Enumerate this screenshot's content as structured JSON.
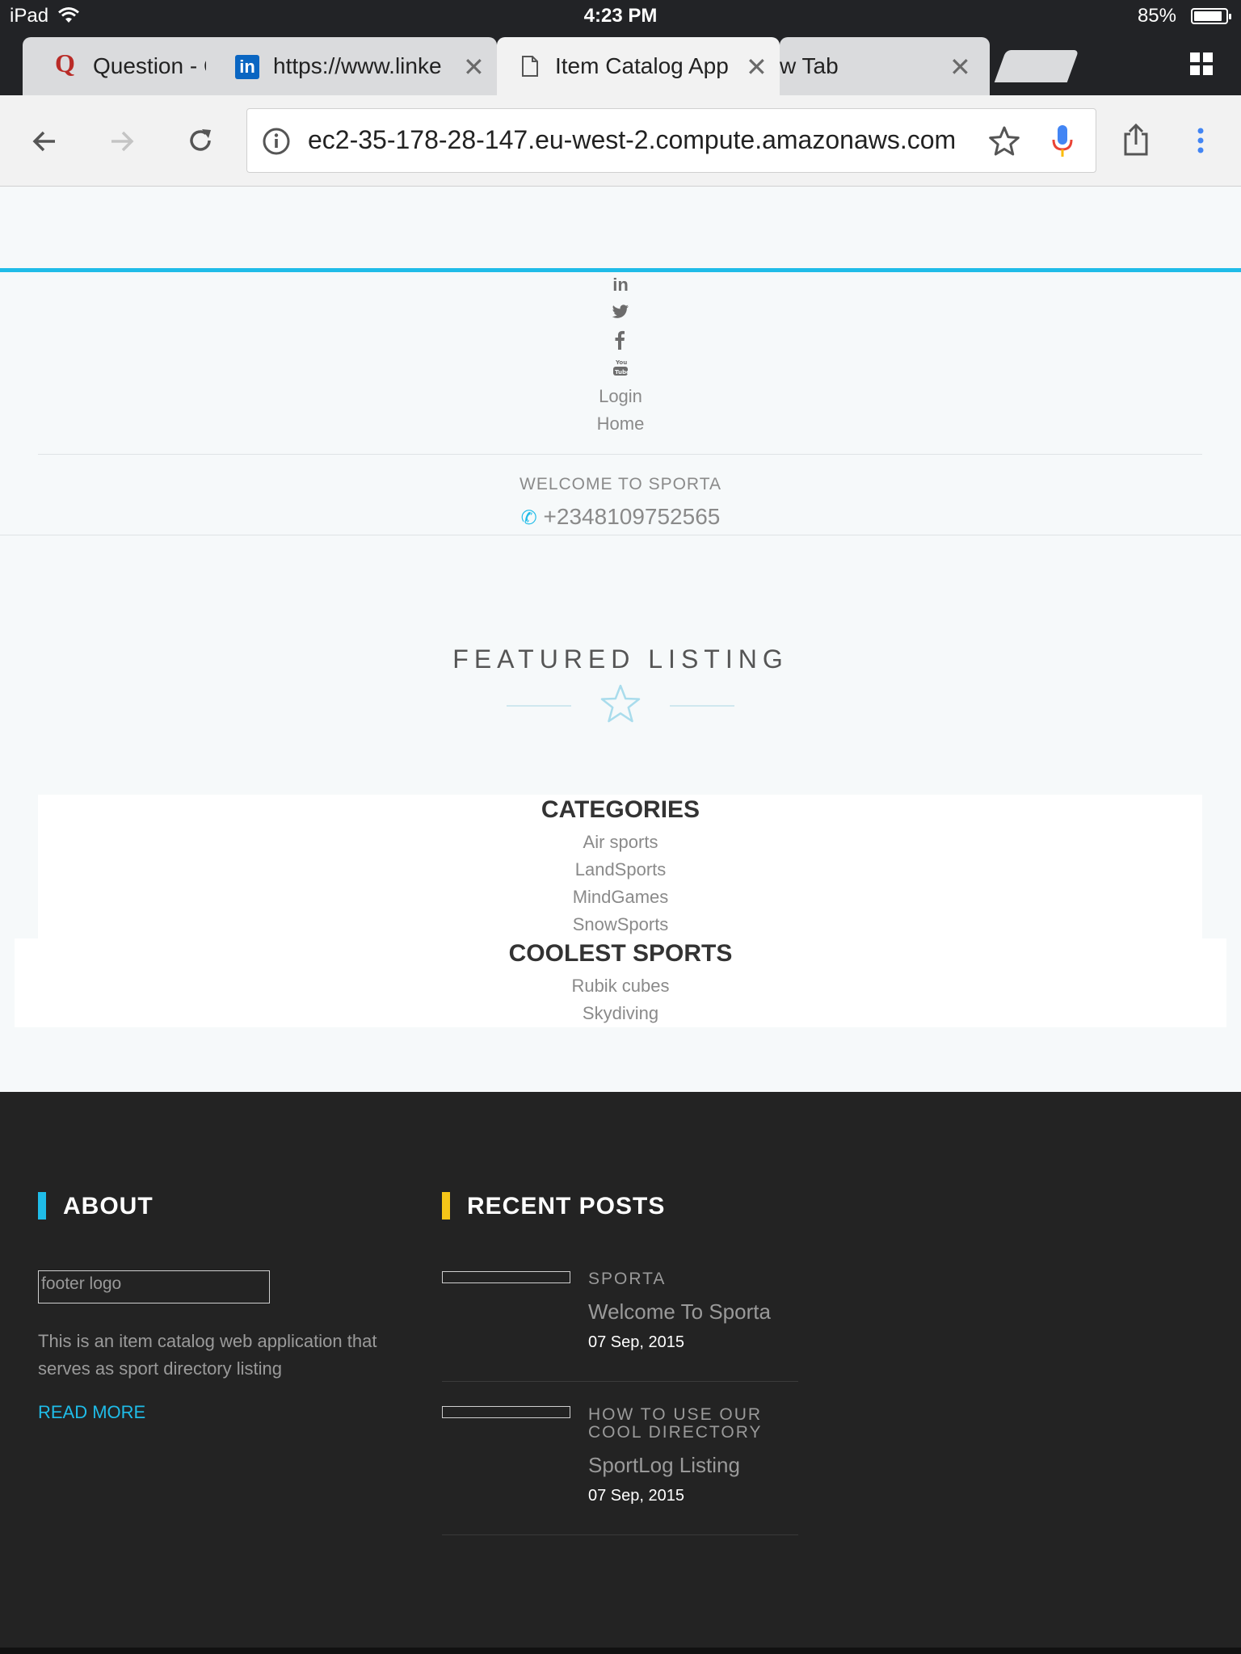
{
  "status_bar": {
    "device": "iPad",
    "time": "4:23 PM",
    "battery": "85%"
  },
  "tabs": [
    {
      "label": "Question - Q",
      "icon": "quora-icon"
    },
    {
      "label": "https://www.linke",
      "icon": "linkedin-icon"
    },
    {
      "label": "Item Catalog App",
      "icon": "page-icon"
    },
    {
      "label": "w Tab"
    }
  ],
  "toolbar": {
    "url": "ec2-35-178-28-147.eu-west-2.compute.amazonaws.com"
  },
  "header": {
    "nav": {
      "login": "Login",
      "home": "Home"
    },
    "welcome": "WELCOME TO SPORTA",
    "phone": "+2348109752565"
  },
  "featured": {
    "title": "FEATURED LISTING"
  },
  "categories": {
    "title": "CATEGORIES",
    "items": [
      "Air sports",
      "LandSports",
      "MindGames",
      "SnowSports"
    ]
  },
  "coolest": {
    "title": "COOLEST SPORTS",
    "items": [
      "Rubik cubes",
      "Skydiving"
    ]
  },
  "footer": {
    "about": {
      "title": "ABOUT",
      "logo_alt": "footer logo",
      "text": "This is an item catalog web application that serves as sport directory listing",
      "read_more": "READ MORE"
    },
    "recent": {
      "title": "RECENT POSTS",
      "posts": [
        {
          "category": "SPORTA",
          "title": "Welcome To Sporta",
          "date": "07 Sep, 2015"
        },
        {
          "category": "HOW TO USE OUR COOL DIRECTORY",
          "title": "SportLog Listing",
          "date": "07 Sep, 2015"
        }
      ]
    }
  },
  "colors": {
    "accent": "#1fbce8",
    "footer_bg": "#232323",
    "recent_bar": "#f5c518"
  }
}
